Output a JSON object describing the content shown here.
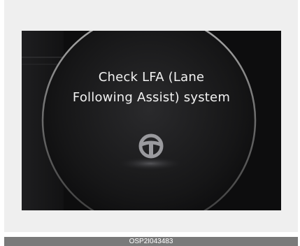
{
  "display": {
    "message_line1": "Check LFA (Lane",
    "message_line2": "Following Assist) system",
    "icon": "steering-wheel-icon",
    "colors": {
      "screen_background": "#0d0d0e",
      "text": "#f2f2f2",
      "gauge_ring": "#8a8a8a"
    }
  },
  "caption": {
    "code": "OSP2I043483"
  }
}
